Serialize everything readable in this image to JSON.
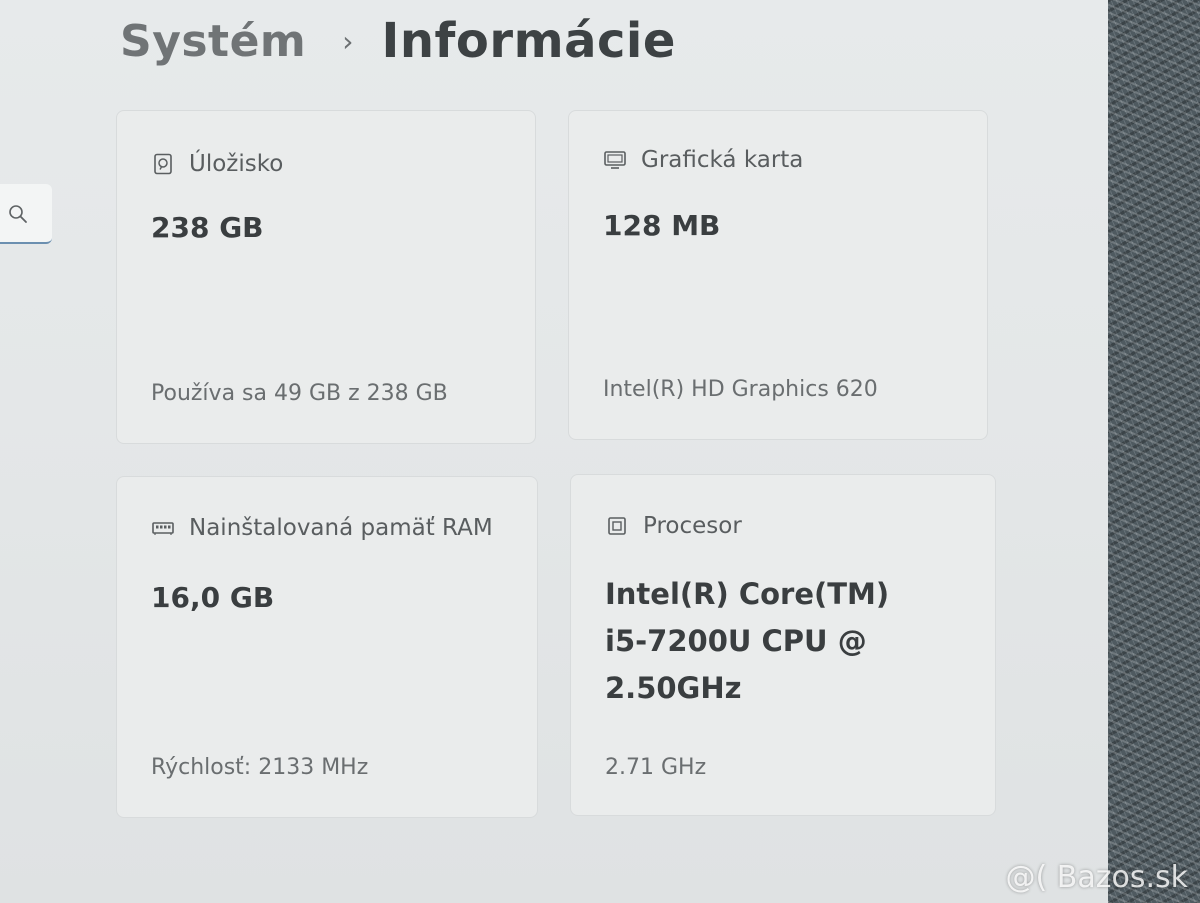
{
  "breadcrumb": {
    "parent": "Systém",
    "separator": "›",
    "current": "Informácie"
  },
  "search": {
    "icon": "search-icon"
  },
  "cards": {
    "storage": {
      "icon": "hard-drive-icon",
      "title": "Úložisko",
      "value": "238 GB",
      "sub": "Používa sa 49 GB z 238 GB"
    },
    "graphics": {
      "icon": "monitor-icon",
      "title": "Grafická karta",
      "value": "128 MB",
      "sub": "Intel(R) HD Graphics 620"
    },
    "ram": {
      "icon": "memory-icon",
      "title": "Nainštalovaná pamäť RAM",
      "value": "16,0 GB",
      "sub": "Rýchlosť: 2133 MHz"
    },
    "cpu": {
      "icon": "processor-icon",
      "title": "Procesor",
      "value": "Intel(R) Core(TM) i5-7200U CPU @ 2.50GHz",
      "sub": "2.71 GHz"
    }
  },
  "watermark": "@( Bazos.sk",
  "colors": {
    "background": "#e4e7e8",
    "card": "#eaecec",
    "accent": "#6b8fb0"
  }
}
